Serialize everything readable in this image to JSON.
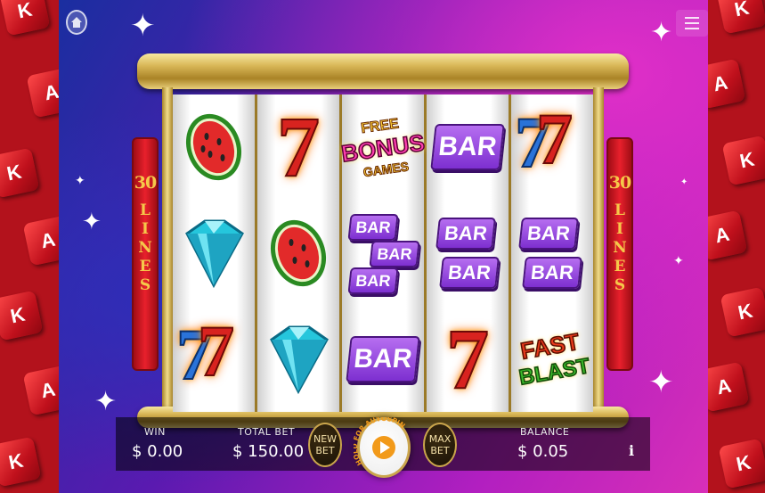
{
  "lines_panel": {
    "count": "30",
    "word": "LINES"
  },
  "reels": [
    [
      "watermelon",
      "diamond",
      "seven-blue-red"
    ],
    [
      "seven",
      "watermelon",
      "diamond"
    ],
    [
      "bonus",
      "bar-triple",
      "bar"
    ],
    [
      "bar",
      "bar-double",
      "seven"
    ],
    [
      "seven-blue-red",
      "bar-double-2",
      "fast-blast"
    ]
  ],
  "symbols": {
    "bar": "BAR",
    "seven": "7",
    "bonus": {
      "line1": "FREE",
      "line2": "BONUS",
      "line3": "GAMES"
    },
    "fast_blast": {
      "line1": "FAST",
      "line2": "BLAST"
    },
    "dice_letter": "K",
    "dice_letter_2": "A"
  },
  "bottom": {
    "win_label": "WIN",
    "win_value": "$ 0.00",
    "total_bet_label": "TOTAL BET",
    "total_bet_value": "$ 150.00",
    "new_bet_line1": "NEW",
    "new_bet_line2": "BET",
    "hold_text": "HOLD FOR AUTOSPIN",
    "max_bet_line1": "MAX",
    "max_bet_line2": "BET",
    "balance_label": "BALANCE",
    "balance_value": "$ 0.05",
    "info": "i"
  },
  "icons": {
    "home": "home-icon",
    "menu": "hamburger-menu-icon",
    "spin": "spin-play-icon",
    "info": "info-icon"
  },
  "colors": {
    "side_panel": "#b3121c",
    "gold": "#d8b656",
    "bar_purple": "#7d2fd0",
    "spin_orange": "#f29a1a"
  }
}
